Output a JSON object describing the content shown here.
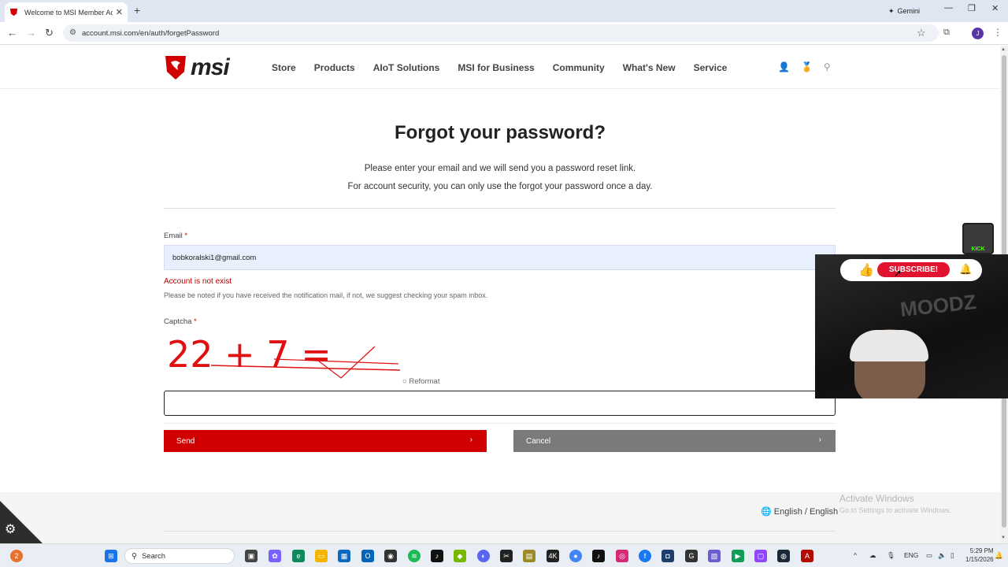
{
  "browser": {
    "tab_title": "Welcome to MSI Member Acco",
    "new_tab": "+",
    "gemini_label": "Gemini",
    "url": "account.msi.com/en/auth/forgetPassword",
    "profile_initial": "J"
  },
  "site": {
    "logo_text": "msi",
    "nav": [
      "Store",
      "Products",
      "AIoT Solutions",
      "MSI for Business",
      "Community",
      "What's New",
      "Service"
    ]
  },
  "page": {
    "title": "Forgot your password?",
    "intro_line1": "Please enter your email and we will send you a password reset link.",
    "intro_line2": "For account security, you can only use the forgot your password once a day."
  },
  "form": {
    "email_label": "Email",
    "required_mark": "*",
    "email_value": "bobkoralski1@gmail.com",
    "error": "Account is not exist",
    "note": "Please be noted if you have received the notification mail, if not, we suggest checking your spam inbox.",
    "captcha_label": "Captcha",
    "captcha_text": "22 + 7 =",
    "reformat_label": "Reformat",
    "captcha_value": "",
    "send_label": "Send",
    "cancel_label": "Cancel"
  },
  "footer": {
    "language": "English / English",
    "activate_title": "Activate Windows",
    "activate_sub": "Go to Settings to activate Windows."
  },
  "overlay": {
    "kick_label": "KICK",
    "subscribe_label": "SUBSCRIBE!",
    "background_text": "MOODZ"
  },
  "taskbar": {
    "search_placeholder": "Search",
    "notification_count": "2",
    "lang": "ENG",
    "time": "5:29 PM",
    "date": "1/15/2026"
  },
  "colors": {
    "brand_red": "#d10000",
    "cancel_gray": "#7a7a7a",
    "autofill_blue": "#e8f0fe",
    "error_red": "#b00000"
  }
}
